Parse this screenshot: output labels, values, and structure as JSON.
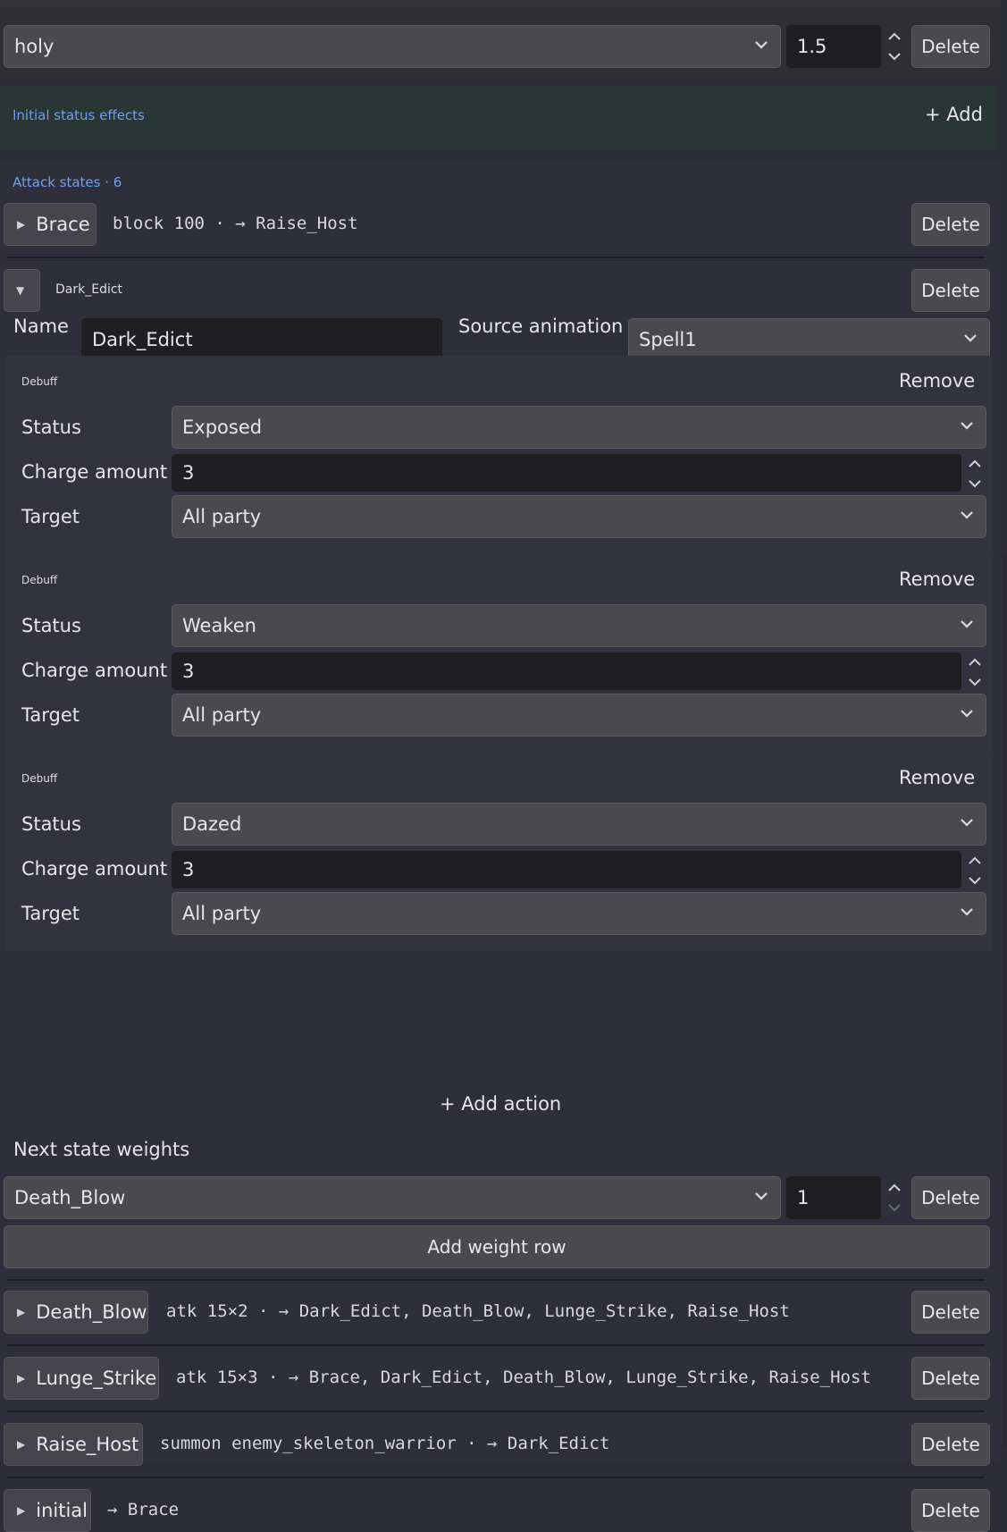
{
  "resistance_row": {
    "type_value": "holy",
    "multiplier": "1.5",
    "delete_label": "Delete"
  },
  "status_effects": {
    "label": "Initial status effects",
    "add_label": "+ Add"
  },
  "attack_states": {
    "label": "Attack states · 6",
    "collapsed_top": {
      "name": "Brace",
      "summary": "block 100 · → Raise_Host",
      "delete_label": "Delete"
    },
    "expanded": {
      "header_name": "Dark_Edict",
      "delete_label": "Delete",
      "name_label": "Name",
      "name_value": "Dark_Edict",
      "source_label": "Source animation",
      "source_value": "Spell1",
      "actions": [
        {
          "kind": "Debuff",
          "remove_label": "Remove",
          "status_label": "Status",
          "status_value": "Exposed",
          "charge_label": "Charge amount",
          "charge_value": "3",
          "target_label": "Target",
          "target_value": "All party"
        },
        {
          "kind": "Debuff",
          "remove_label": "Remove",
          "status_label": "Status",
          "status_value": "Weaken",
          "charge_label": "Charge amount",
          "charge_value": "3",
          "target_label": "Target",
          "target_value": "All party"
        },
        {
          "kind": "Debuff",
          "remove_label": "Remove",
          "status_label": "Status",
          "status_value": "Dazed",
          "charge_label": "Charge amount",
          "charge_value": "3",
          "target_label": "Target",
          "target_value": "All party"
        }
      ],
      "add_action_label": "+ Add action",
      "weights_label": "Next state weights",
      "weight_row": {
        "state": "Death_Blow",
        "weight": "1",
        "delete_label": "Delete"
      },
      "add_weight_label": "Add weight row"
    },
    "collapsed_rest": [
      {
        "name": "Death_Blow",
        "summary": "atk 15×2 · → Dark_Edict, Death_Blow, Lunge_Strike, Raise_Host",
        "delete_label": "Delete"
      },
      {
        "name": "Lunge_Strike",
        "summary": "atk 15×3 · → Brace, Dark_Edict, Death_Blow, Lunge_Strike, Raise_Host",
        "delete_label": "Delete"
      },
      {
        "name": "Raise_Host",
        "summary": "summon enemy_skeleton_warrior · → Dark_Edict",
        "delete_label": "Delete"
      },
      {
        "name": "initial",
        "summary": "→ Brace",
        "delete_label": "Delete"
      }
    ]
  },
  "icons": [
    "chevron-down-icon",
    "spin-up-icon",
    "spin-down-icon",
    "expand-triangle-icon",
    "collapse-triangle-icon"
  ],
  "colors": {
    "background": "#2d2d38",
    "accent_blue": "#6ea0e8",
    "status_panel": "#2a3635",
    "input_dark": "#1f1f22",
    "control": "#4a4a4e"
  }
}
